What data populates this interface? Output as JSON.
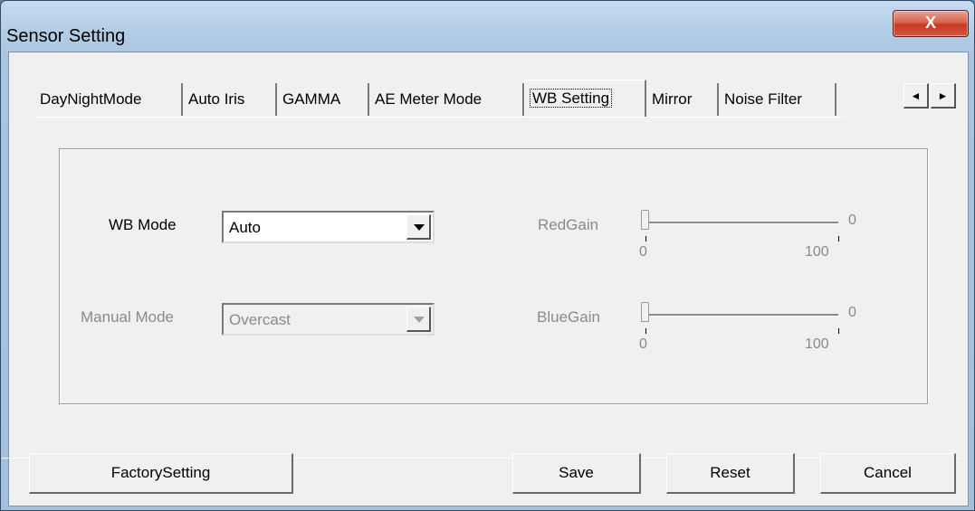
{
  "window": {
    "title": "Sensor Setting",
    "close_label": "X"
  },
  "tabs": [
    {
      "label": "DayNightMode",
      "active": false
    },
    {
      "label": "Auto Iris",
      "active": false
    },
    {
      "label": "GAMMA",
      "active": false
    },
    {
      "label": "AE Meter Mode",
      "active": false
    },
    {
      "label": "WB Setting",
      "active": true
    },
    {
      "label": "Mirror",
      "active": false
    },
    {
      "label": "Noise Filter",
      "active": false
    }
  ],
  "tab_scroll": {
    "left_icon": "◄",
    "right_icon": "►"
  },
  "wb_mode": {
    "label": "WB Mode",
    "value": "Auto"
  },
  "manual_mode": {
    "label": "Manual Mode",
    "value": "Overcast",
    "enabled": false
  },
  "red_gain": {
    "label": "RedGain",
    "min": "0",
    "max": "100",
    "current": "0",
    "fraction": 0,
    "enabled": false
  },
  "blue_gain": {
    "label": "BlueGain",
    "min": "0",
    "max": "100",
    "current": "0",
    "fraction": 0,
    "enabled": false
  },
  "buttons": {
    "factory": "FactorySetting",
    "save": "Save",
    "reset": "Reset",
    "cancel": "Cancel"
  },
  "colors": {
    "disabled_text": "#8a8a8a",
    "close_button": "#c33b23"
  }
}
